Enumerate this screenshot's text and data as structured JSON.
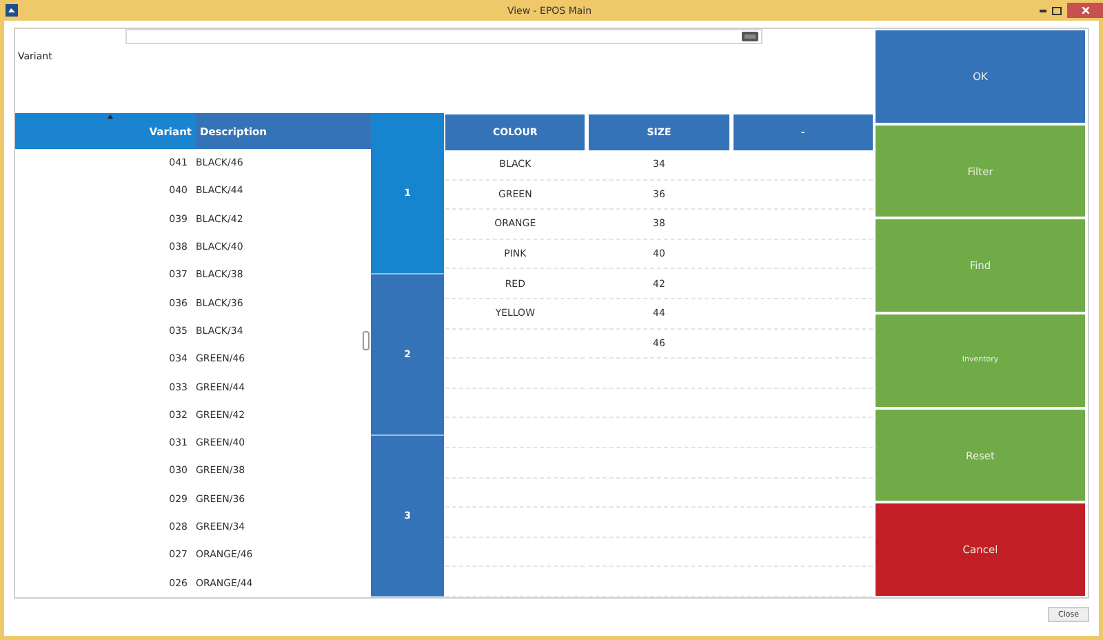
{
  "window": {
    "title": "View - EPOS Main"
  },
  "variant_label": "Variant",
  "variant_table": {
    "columns": [
      {
        "label": "Variant",
        "sorted": true
      },
      {
        "label": "Description",
        "sorted": false
      }
    ],
    "rows": [
      {
        "variant": "041",
        "description": "BLACK/46"
      },
      {
        "variant": "040",
        "description": "BLACK/44"
      },
      {
        "variant": "039",
        "description": "BLACK/42"
      },
      {
        "variant": "038",
        "description": "BLACK/40"
      },
      {
        "variant": "037",
        "description": "BLACK/38"
      },
      {
        "variant": "036",
        "description": "BLACK/36"
      },
      {
        "variant": "035",
        "description": "BLACK/34"
      },
      {
        "variant": "034",
        "description": "GREEN/46"
      },
      {
        "variant": "033",
        "description": "GREEN/44"
      },
      {
        "variant": "032",
        "description": "GREEN/42"
      },
      {
        "variant": "031",
        "description": "GREEN/40"
      },
      {
        "variant": "030",
        "description": "GREEN/38"
      },
      {
        "variant": "029",
        "description": "GREEN/36"
      },
      {
        "variant": "028",
        "description": "GREEN/34"
      },
      {
        "variant": "027",
        "description": "ORANGE/46"
      },
      {
        "variant": "026",
        "description": "ORANGE/44"
      }
    ]
  },
  "pages": [
    {
      "label": "1",
      "selected": true
    },
    {
      "label": "2",
      "selected": false
    },
    {
      "label": "3",
      "selected": false
    }
  ],
  "attributes": [
    {
      "heading": "COLOUR",
      "values": [
        "BLACK",
        "GREEN",
        "ORANGE",
        "PINK",
        "RED",
        "YELLOW"
      ]
    },
    {
      "heading": "SIZE",
      "values": [
        "34",
        "36",
        "38",
        "40",
        "42",
        "44",
        "46"
      ]
    },
    {
      "heading": "-"
    }
  ],
  "actions": [
    {
      "label": "OK",
      "kind": "primary"
    },
    {
      "label": "Filter",
      "kind": "secondary"
    },
    {
      "label": "Find",
      "kind": "secondary"
    },
    {
      "label": "Inventory",
      "kind": "secondary",
      "small": true
    },
    {
      "label": "Reset",
      "kind": "secondary"
    },
    {
      "label": "Cancel",
      "kind": "danger"
    }
  ],
  "footer_button": "Close"
}
